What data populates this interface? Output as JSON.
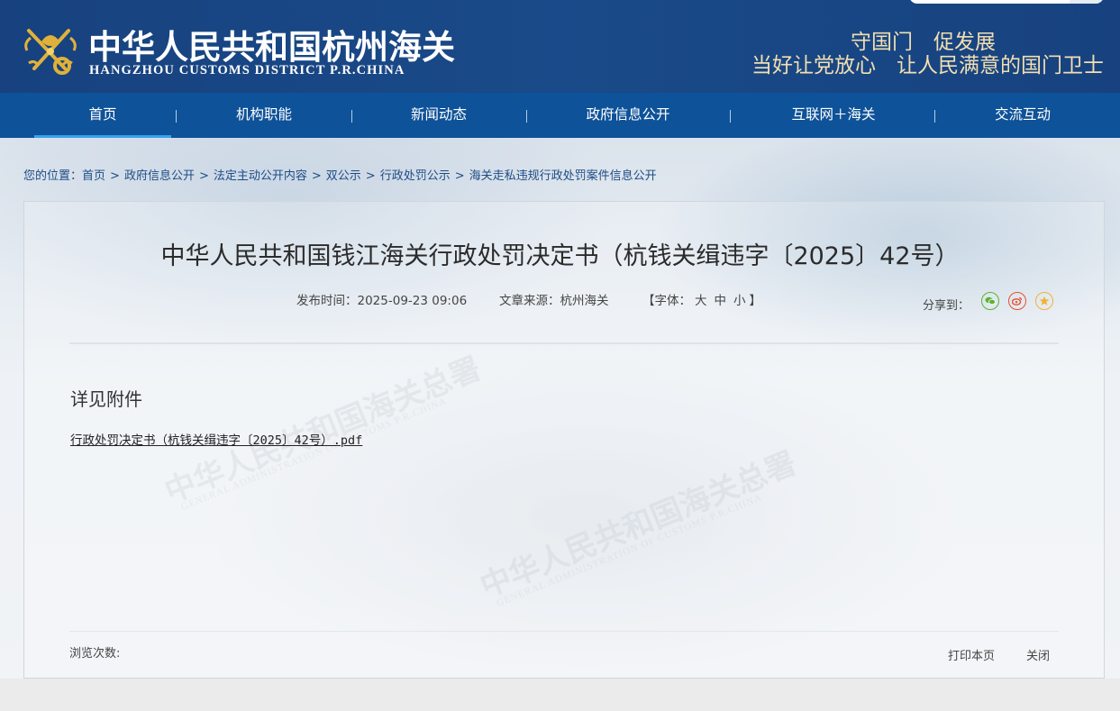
{
  "header": {
    "logo_cn": "中华人民共和国杭州海关",
    "logo_en": "HANGZHOU CUSTOMS DISTRICT P.R.CHINA",
    "slogan_line1": "守国门　促发展",
    "slogan_line2": "当好让党放心　让人民满意的国门卫士",
    "emblem_icon": "customs-emblem-icon"
  },
  "nav": {
    "items": [
      {
        "label": "首页"
      },
      {
        "label": "机构职能"
      },
      {
        "label": "新闻动态"
      },
      {
        "label": "政府信息公开"
      },
      {
        "label": "互联网＋海关"
      },
      {
        "label": "交流互动"
      }
    ],
    "separator": "|"
  },
  "breadcrumb": {
    "prefix": "您的位置：",
    "items": [
      {
        "label": "首页"
      },
      {
        "label": "政府信息公开"
      },
      {
        "label": "法定主动公开内容"
      },
      {
        "label": "双公示"
      },
      {
        "label": "行政处罚公示"
      },
      {
        "label": "海关走私违规行政处罚案件信息公开"
      }
    ],
    "separator": ">"
  },
  "article": {
    "title": "中华人民共和国钱江海关行政处罚决定书（杭钱关缉违字〔2025〕42号）",
    "publish_label": "发布时间：",
    "publish_time": "2025-09-23 09:06",
    "source_label": "文章来源：",
    "source": "杭州海关",
    "font_open": "【字体：",
    "font_large": "大",
    "font_medium": "中",
    "font_small": "小",
    "font_close": "】",
    "share_label": "分享到：",
    "share_icons": [
      "wechat-icon",
      "weibo-icon",
      "favorite-icon"
    ],
    "body": "详见附件",
    "attachment": "行政处罚决定书（杭钱关缉违字〔2025〕42号）.pdf",
    "views_label": "浏览次数:",
    "print_label": "打印本页",
    "close_label": "关闭"
  },
  "watermark": {
    "cn": "中华人民共和国海关总署",
    "en": "GENERAL ADMINISTRATION OF CUSTOMS P.R.CHINA"
  },
  "colors": {
    "header_bg": "#17427f",
    "nav_bg": "#0e5299",
    "nav_active_underline": "#38a2ec",
    "slogan": "#f2dfb0",
    "breadcrumb": "#1d4c85",
    "wechat": "#5fb236",
    "weibo": "#e8502f",
    "favorite": "#f2b233"
  }
}
